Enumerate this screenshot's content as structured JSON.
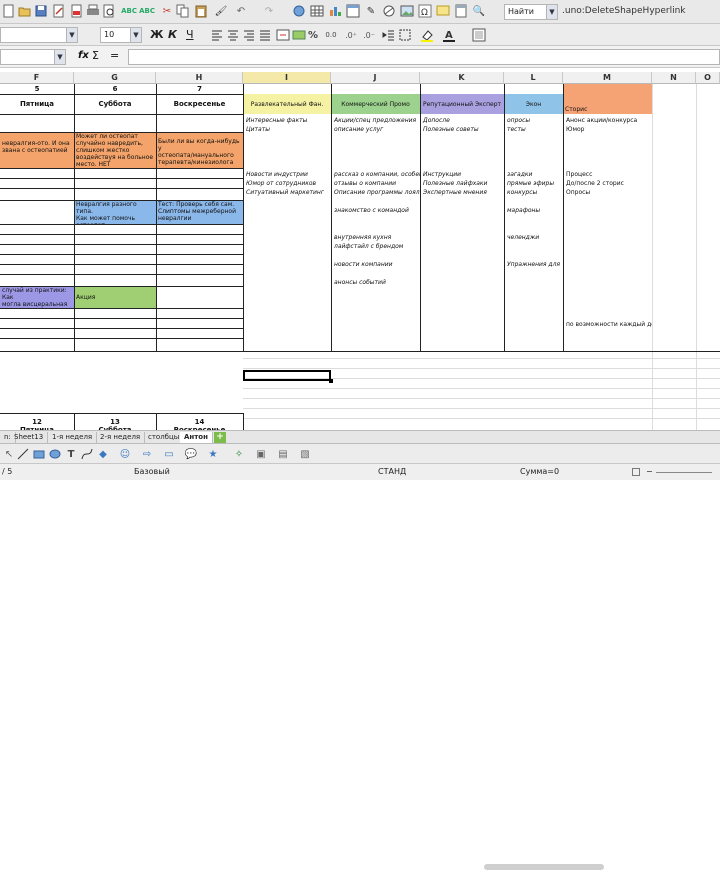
{
  "toolbar": {
    "find_placeholder": "Найти",
    "command_text": ".uno:DeleteShapeHyperlink",
    "bold": "Ж",
    "italic": "К",
    "underline": "Ч",
    "font_size": "10",
    "percent": "%",
    "decimal": "0.0"
  },
  "formula_bar": {
    "fx": "fx",
    "sigma": "Σ",
    "equals": "="
  },
  "columns": [
    "F",
    "G",
    "H",
    "I",
    "J",
    "K",
    "L",
    "M",
    "N",
    "O"
  ],
  "day_numbers": [
    "5",
    "6",
    "7"
  ],
  "days": [
    "Пятница",
    "Суббота",
    "Воскресенье"
  ],
  "day_numbers_bottom": [
    "12",
    "13",
    "14"
  ],
  "days_bottom": [
    "Пятница",
    "Суббота",
    "Воскресенье"
  ],
  "category_headers": [
    "Развлекательный Фан.",
    "Коммерческий Промо",
    "Репутационный Эксперт",
    "Экон",
    "Сторис"
  ],
  "colors": {
    "orange": "#f4a46a",
    "blue": "#8bb8ea",
    "purple": "#9d98e6",
    "green": "#9fcf72",
    "yellow": "#f6f2a4",
    "j_green": "#9cd28e",
    "k_violet": "#a9a1df",
    "l_blue": "#8fc3e8",
    "m_orange": "#f5a275"
  },
  "cells": {
    "f_orange": "невралгия-ото. И она\nзвана с остеопатией",
    "g_orange": "Может ли остеопат\nслучайно навредить,\nслишком жестко\nвоздействуя на больное\nместо. НЕТ",
    "h_orange": "Были ли вы когда-нибудь у\nостеопата/мануального\nтерапевта/кинезиолога",
    "g_blue": "Невралгия разного типа.\nКак может помочь\nостеопат",
    "h_blue": "Тест: Проверь себя сам.\nСлиптомы межреберной\nневралгии",
    "f_purple": "случай из практики: Как\nмогла висцеральная\nпатия",
    "g_green": "Акция"
  },
  "col_i": [
    "Интересные факты",
    "Цитаты",
    "",
    "",
    "",
    "",
    "Новости индустрии",
    "Юмор от сотрудников",
    "Ситуативный маркетинг"
  ],
  "col_j": [
    "Акции/спец предложения",
    "описание услуг",
    "",
    "",
    "",
    "",
    "рассказ о компании, особенно",
    "отзывы о компании",
    "Описание программы лояльн",
    "",
    "знакомство с командой",
    "",
    "",
    "внутренняя кухня",
    "лайфстайл с брендом",
    "",
    "новости компании",
    "",
    "анонсы событий"
  ],
  "col_k": [
    "Допосле",
    "Полезные советы",
    "",
    "",
    "",
    "",
    "Инструкции",
    "Полезные лайфхаки",
    "Экспертные мнения"
  ],
  "col_l": [
    "опросы",
    "тесты",
    "",
    "",
    "",
    "",
    "загадки",
    "прямые эфиры",
    "конкурсы",
    "",
    "марафоны",
    "",
    "",
    "челенджи",
    "",
    "",
    "Упражнения для"
  ],
  "col_m": [
    "Анонс акции/конкурса",
    "Юмор",
    "",
    "",
    "",
    "",
    "Процесс",
    "До/после 2 сторис",
    "Опросы"
  ],
  "m_bottom": "по возможности каждый день",
  "sheet_tabs": [
    "Sheet13",
    "1-я неделя",
    "2-я неделя",
    "столбцы",
    "Антон"
  ],
  "status": {
    "page": "/ 5",
    "style": "Базовый",
    "mode": "СТАНД",
    "sum": "Сумма=0"
  },
  "partial_label": "n:"
}
